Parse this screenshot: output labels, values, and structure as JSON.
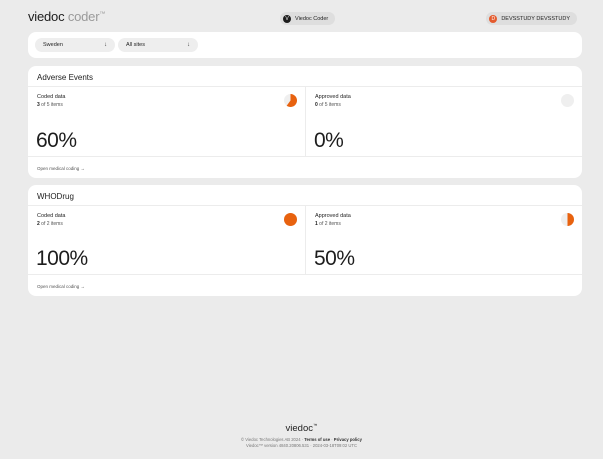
{
  "header": {
    "logo_brand": "viedoc",
    "logo_product": "coder",
    "logo_tm": "™",
    "app_initial": "V",
    "app_name": "Viedoc Coder",
    "user_initial": "D",
    "user_name": "DEVSSTUDY DEVSSTUDY"
  },
  "filters": {
    "country": "Sweden",
    "site": "All sites",
    "arrow": "↓"
  },
  "sections": [
    {
      "title": "Adverse Events",
      "coded": {
        "label": "Coded data",
        "count": "3",
        "of_text": "of 5 items",
        "percent": "60%",
        "fraction": 0.6
      },
      "approved": {
        "label": "Approved data",
        "count": "0",
        "of_text": "of 5 items",
        "percent": "0%",
        "fraction": 0.0
      },
      "link": "Open medical coding →"
    },
    {
      "title": "WHODrug",
      "coded": {
        "label": "Coded data",
        "count": "2",
        "of_text": "of 2 items",
        "percent": "100%",
        "fraction": 1.0
      },
      "approved": {
        "label": "Approved data",
        "count": "1",
        "of_text": "of 2 items",
        "percent": "50%",
        "fraction": 0.5
      },
      "link": "Open medical coding →"
    }
  ],
  "footer": {
    "logo": "viedoc",
    "logo_tm": "™",
    "copyright": "© Viedoc Technologies AB 2024",
    "sep": "·",
    "terms": "Terms of use",
    "privacy": "Privacy policy",
    "version_line": "Viedoc™ version 4840.20806.531 · 2024-03-18T09:02 UTC"
  },
  "colors": {
    "accent": "#e8620f",
    "pie_bg": "#efefef"
  },
  "icons": {
    "country_arrow": "arrow-down-icon",
    "site_arrow": "arrow-down-icon",
    "progress": "pie-progress-icon"
  }
}
